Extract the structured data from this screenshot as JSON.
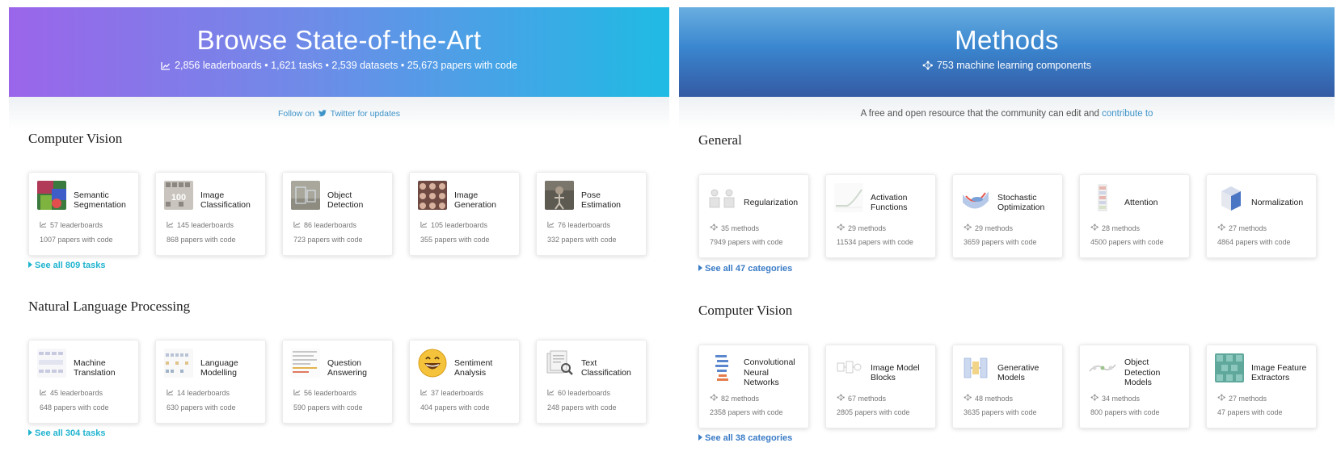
{
  "left": {
    "hero": {
      "title": "Browse State-of-the-Art",
      "subtitle": "2,856 leaderboards • 1,621 tasks • 2,539 datasets • 25,673 papers with code",
      "icon": "chart-line-icon"
    },
    "banner": {
      "prefix": "Follow on",
      "link": "Twitter for updates",
      "icon": "twitter-icon"
    },
    "sections": [
      {
        "title": "Computer Vision",
        "see_all": "See all 809 tasks",
        "cards": [
          {
            "name": "Semantic Segmentation",
            "stat1": "57 leaderboards",
            "stat2": "1007 papers with code"
          },
          {
            "name": "Image Classification",
            "stat1": "145 leaderboards",
            "stat2": "868 papers with code"
          },
          {
            "name": "Object Detection",
            "stat1": "86 leaderboards",
            "stat2": "723 papers with code"
          },
          {
            "name": "Image Generation",
            "stat1": "105 leaderboards",
            "stat2": "355 papers with code"
          },
          {
            "name": "Pose Estimation",
            "stat1": "76 leaderboards",
            "stat2": "332 papers with code"
          }
        ]
      },
      {
        "title": "Natural Language Processing",
        "see_all": "See all 304 tasks",
        "cards": [
          {
            "name": "Machine Translation",
            "stat1": "45 leaderboards",
            "stat2": "648 papers with code"
          },
          {
            "name": "Language Modelling",
            "stat1": "14 leaderboards",
            "stat2": "630 papers with code"
          },
          {
            "name": "Question Answering",
            "stat1": "56 leaderboards",
            "stat2": "590 papers with code"
          },
          {
            "name": "Sentiment Analysis",
            "stat1": "37 leaderboards",
            "stat2": "404 papers with code"
          },
          {
            "name": "Text Classification",
            "stat1": "60 leaderboards",
            "stat2": "248 papers with code"
          }
        ]
      }
    ]
  },
  "right": {
    "hero": {
      "title": "Methods",
      "subtitle": "753 machine learning components",
      "icon": "network-icon"
    },
    "banner": {
      "prefix": "A free and open resource that the community can edit and",
      "link": "contribute to"
    },
    "sections": [
      {
        "title": "General",
        "see_all": "See all 47 categories",
        "cards": [
          {
            "name": "Regularization",
            "stat1": "35 methods",
            "stat2": "7949 papers with code"
          },
          {
            "name": "Activation Functions",
            "stat1": "29 methods",
            "stat2": "11534 papers with code"
          },
          {
            "name": "Stochastic Optimization",
            "stat1": "29 methods",
            "stat2": "3659 papers with code"
          },
          {
            "name": "Attention",
            "stat1": "28 methods",
            "stat2": "4500 papers with code"
          },
          {
            "name": "Normalization",
            "stat1": "27 methods",
            "stat2": "4864 papers with code"
          }
        ]
      },
      {
        "title": "Computer Vision",
        "see_all": "See all 38 categories",
        "cards": [
          {
            "name": "Convolutional Neural Networks",
            "stat1": "82 methods",
            "stat2": "2358 papers with code"
          },
          {
            "name": "Image Model Blocks",
            "stat1": "67 methods",
            "stat2": "2805 papers with code"
          },
          {
            "name": "Generative Models",
            "stat1": "48 methods",
            "stat2": "3635 papers with code"
          },
          {
            "name": "Object Detection Models",
            "stat1": "34 methods",
            "stat2": "800 papers with code"
          },
          {
            "name": "Image Feature Extractors",
            "stat1": "27 methods",
            "stat2": "47 papers with code"
          }
        ]
      }
    ]
  }
}
